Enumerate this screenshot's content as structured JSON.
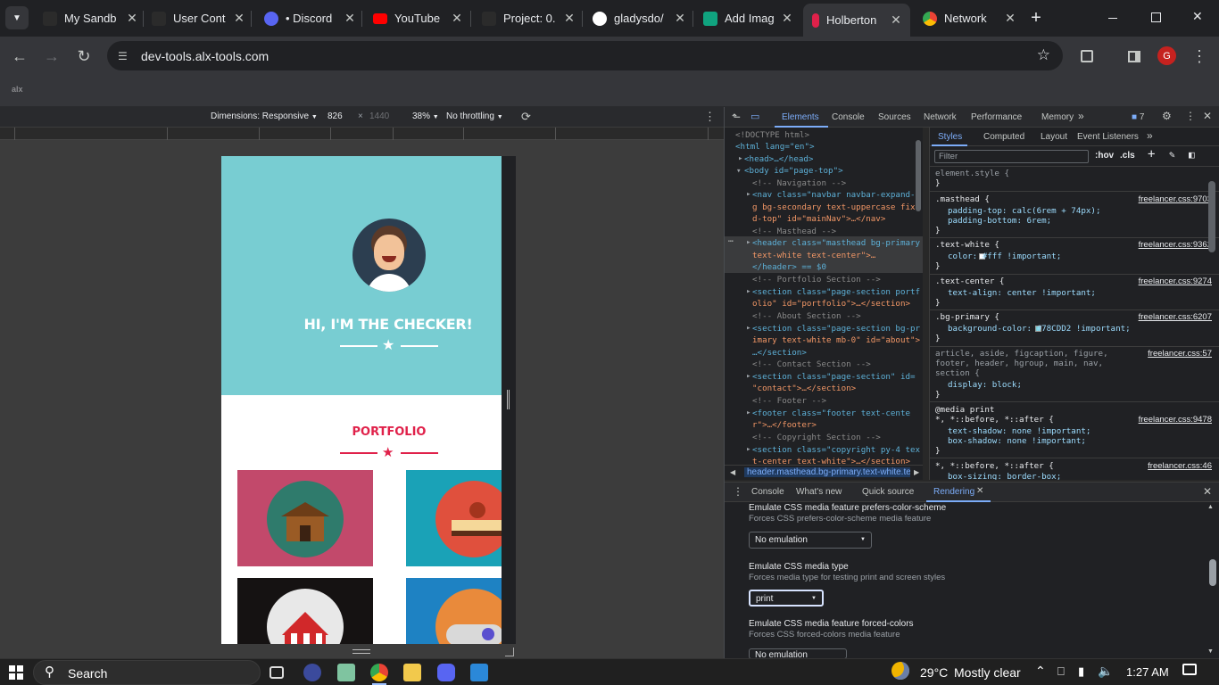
{
  "tabs": [
    {
      "title": "My Sandb",
      "color": "#2b2b2b"
    },
    {
      "title": "User Cont",
      "color": "#2b2b2b"
    },
    {
      "title": "• Discord",
      "color": "#5865f2"
    },
    {
      "title": "YouTube",
      "color": "#ff0000"
    },
    {
      "title": "Project: 0.",
      "color": "#2b2b2b"
    },
    {
      "title": "gladysdo/",
      "color": "#ffffff"
    },
    {
      "title": "Add Imag",
      "color": "#10a37f"
    },
    {
      "title": "Holberton",
      "color": "#e0214a"
    },
    {
      "title": "Network",
      "color": "#4285f4"
    }
  ],
  "toolbar": {
    "url": "dev-tools.alx-tools.com",
    "profile_initial": "G"
  },
  "bookmarks": {
    "item": "alx"
  },
  "device_toolbar": {
    "dimensions_label": "Dimensions: Responsive",
    "width": "826",
    "times": "×",
    "height": "1440",
    "zoom": "38%",
    "throttling": "No throttling"
  },
  "page": {
    "masthead_title": "HI, I'M THE CHECKER!",
    "portfolio_heading": "PORTFOLIO",
    "colors": {
      "primary": "#78CDD2",
      "accent": "#e0214a",
      "dark": "#2c3e50"
    }
  },
  "devtools": {
    "tabs": [
      "Elements",
      "Console",
      "Sources",
      "Network",
      "Performance",
      "Memory"
    ],
    "issues_count": "7",
    "dom_lines": [
      "<!DOCTYPE html>",
      "<html lang=\"en\">",
      "<head>…</head>",
      "<body id=\"page-top\">",
      "<!-- Navigation -->",
      "<nav class=\"navbar navbar-expand-l",
      "g bg-secondary text-uppercase fixe",
      "d-top\" id=\"mainNav\">…</nav>",
      "<!-- Masthead -->",
      "<header class=\"masthead bg-primary",
      "text-white text-center\">…",
      "</header> == $0",
      "<!-- Portfolio Section -->",
      "<section class=\"page-section portf",
      "olio\" id=\"portfolio\">…</section>",
      "<!-- About Section -->",
      "<section class=\"page-section bg-pr",
      "imary text-white mb-0\" id=\"about\">",
      "…</section>",
      "<!-- Contact Section -->",
      "<section class=\"page-section\" id=",
      "\"contact\">…</section>",
      "<!-- Footer -->",
      "<footer class=\"footer text-cente",
      "r\">…</footer>",
      "<!-- Copyright Section -->",
      "<section class=\"copyright py-4 tex",
      "t-center text-white\">…</section>"
    ],
    "breadcrumb": "header.masthead.bg-primary.text-white.text",
    "styles_tabs": [
      "Styles",
      "Computed",
      "Layout",
      "Event Listeners"
    ],
    "filter_placeholder": "Filter",
    "hov": ":hov",
    "cls": ".cls",
    "rules": [
      {
        "selector": "element.style {",
        "props": [],
        "source": ""
      },
      {
        "selector": ".masthead {",
        "props": [
          "padding-top: calc(6rem + 74px);",
          "padding-bottom: 6rem;"
        ],
        "source": "freelancer.css:9703"
      },
      {
        "selector": ".text-white {",
        "props": [
          "color: #fff !important;"
        ],
        "source": "freelancer.css:9362"
      },
      {
        "selector": ".text-center {",
        "props": [
          "text-align: center !important;"
        ],
        "source": "freelancer.css:9274"
      },
      {
        "selector": ".bg-primary {",
        "props": [
          "background-color: #78CDD2 !important;"
        ],
        "source": "freelancer.css:6207"
      },
      {
        "selector": "article, aside, figcaption, figure,",
        "props": [
          "footer, header, hgroup, main, nav,",
          "section {",
          "display: block;"
        ],
        "source": "freelancer.css:57"
      },
      {
        "selector": "@media print",
        "props": [
          "*, *::before, *::after {",
          "text-shadow: none !important;",
          "box-shadow: none !important;"
        ],
        "source": "freelancer.css:9478"
      },
      {
        "selector": "*, *::before, *::after {",
        "props": [
          "box-sizing: border-box;"
        ],
        "source": "freelancer.css:46"
      }
    ],
    "drawer_tabs": [
      "Console",
      "What's new",
      "Quick source",
      "Rendering"
    ],
    "rendering": [
      {
        "title": "Emulate CSS media feature prefers-color-scheme",
        "sub": "Forces CSS prefers-color-scheme media feature",
        "value": "No emulation"
      },
      {
        "title": "Emulate CSS media type",
        "sub": "Forces media type for testing print and screen styles",
        "value": "print"
      },
      {
        "title": "Emulate CSS media feature forced-colors",
        "sub": "Forces CSS forced-colors media feature",
        "value": "No emulation"
      }
    ]
  },
  "taskbar": {
    "search": "Search",
    "temperature": "29°C",
    "weather": "Mostly clear",
    "time": "1:27 AM"
  }
}
